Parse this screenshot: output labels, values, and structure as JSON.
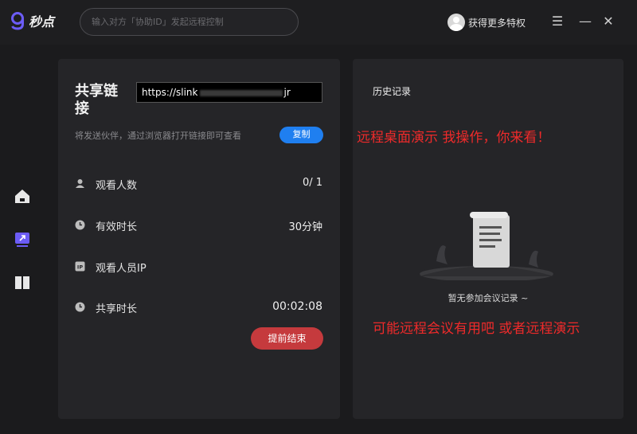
{
  "app": {
    "logo_text": "秒点"
  },
  "search": {
    "placeholder": "输入对方「协助ID」发起远程控制"
  },
  "user": {
    "label": "获得更多特权"
  },
  "window_controls": {
    "menu": "☰",
    "minimize": "—",
    "close": "✕"
  },
  "sidebar": {
    "items": [
      {
        "name": "home-icon"
      },
      {
        "name": "remote-desktop-icon"
      },
      {
        "name": "book-icon"
      }
    ]
  },
  "share": {
    "title": "共享链接",
    "link_prefix": "https://slink",
    "link_suffix": "jr",
    "hint": "将发送伙伴，通过浏览器打开链接即可查看",
    "copy_label": "复制",
    "rows": [
      {
        "label": "观看人数",
        "value": "0/ 1",
        "icon": "user-icon"
      },
      {
        "label": "有效时长",
        "value": "30分钟",
        "icon": "clock-icon"
      },
      {
        "label": "观看人员IP",
        "value": "",
        "icon": "ip-icon"
      },
      {
        "label": "共享时长",
        "value": "00:02:08",
        "icon": "clock-icon"
      }
    ],
    "end_label": "提前结束"
  },
  "history": {
    "title": "历史记录",
    "empty_text": "暂无参加会议记录 ~"
  },
  "annotations": {
    "top": "远程桌面演示   我操作，你来看！",
    "bottom": "可能远程会议有用吧   或者远程演示"
  },
  "colors": {
    "accent": "#1f7ff0",
    "danger": "#c53a3d",
    "annotation": "#ee2a2a",
    "logo": "#6c5cf6"
  }
}
